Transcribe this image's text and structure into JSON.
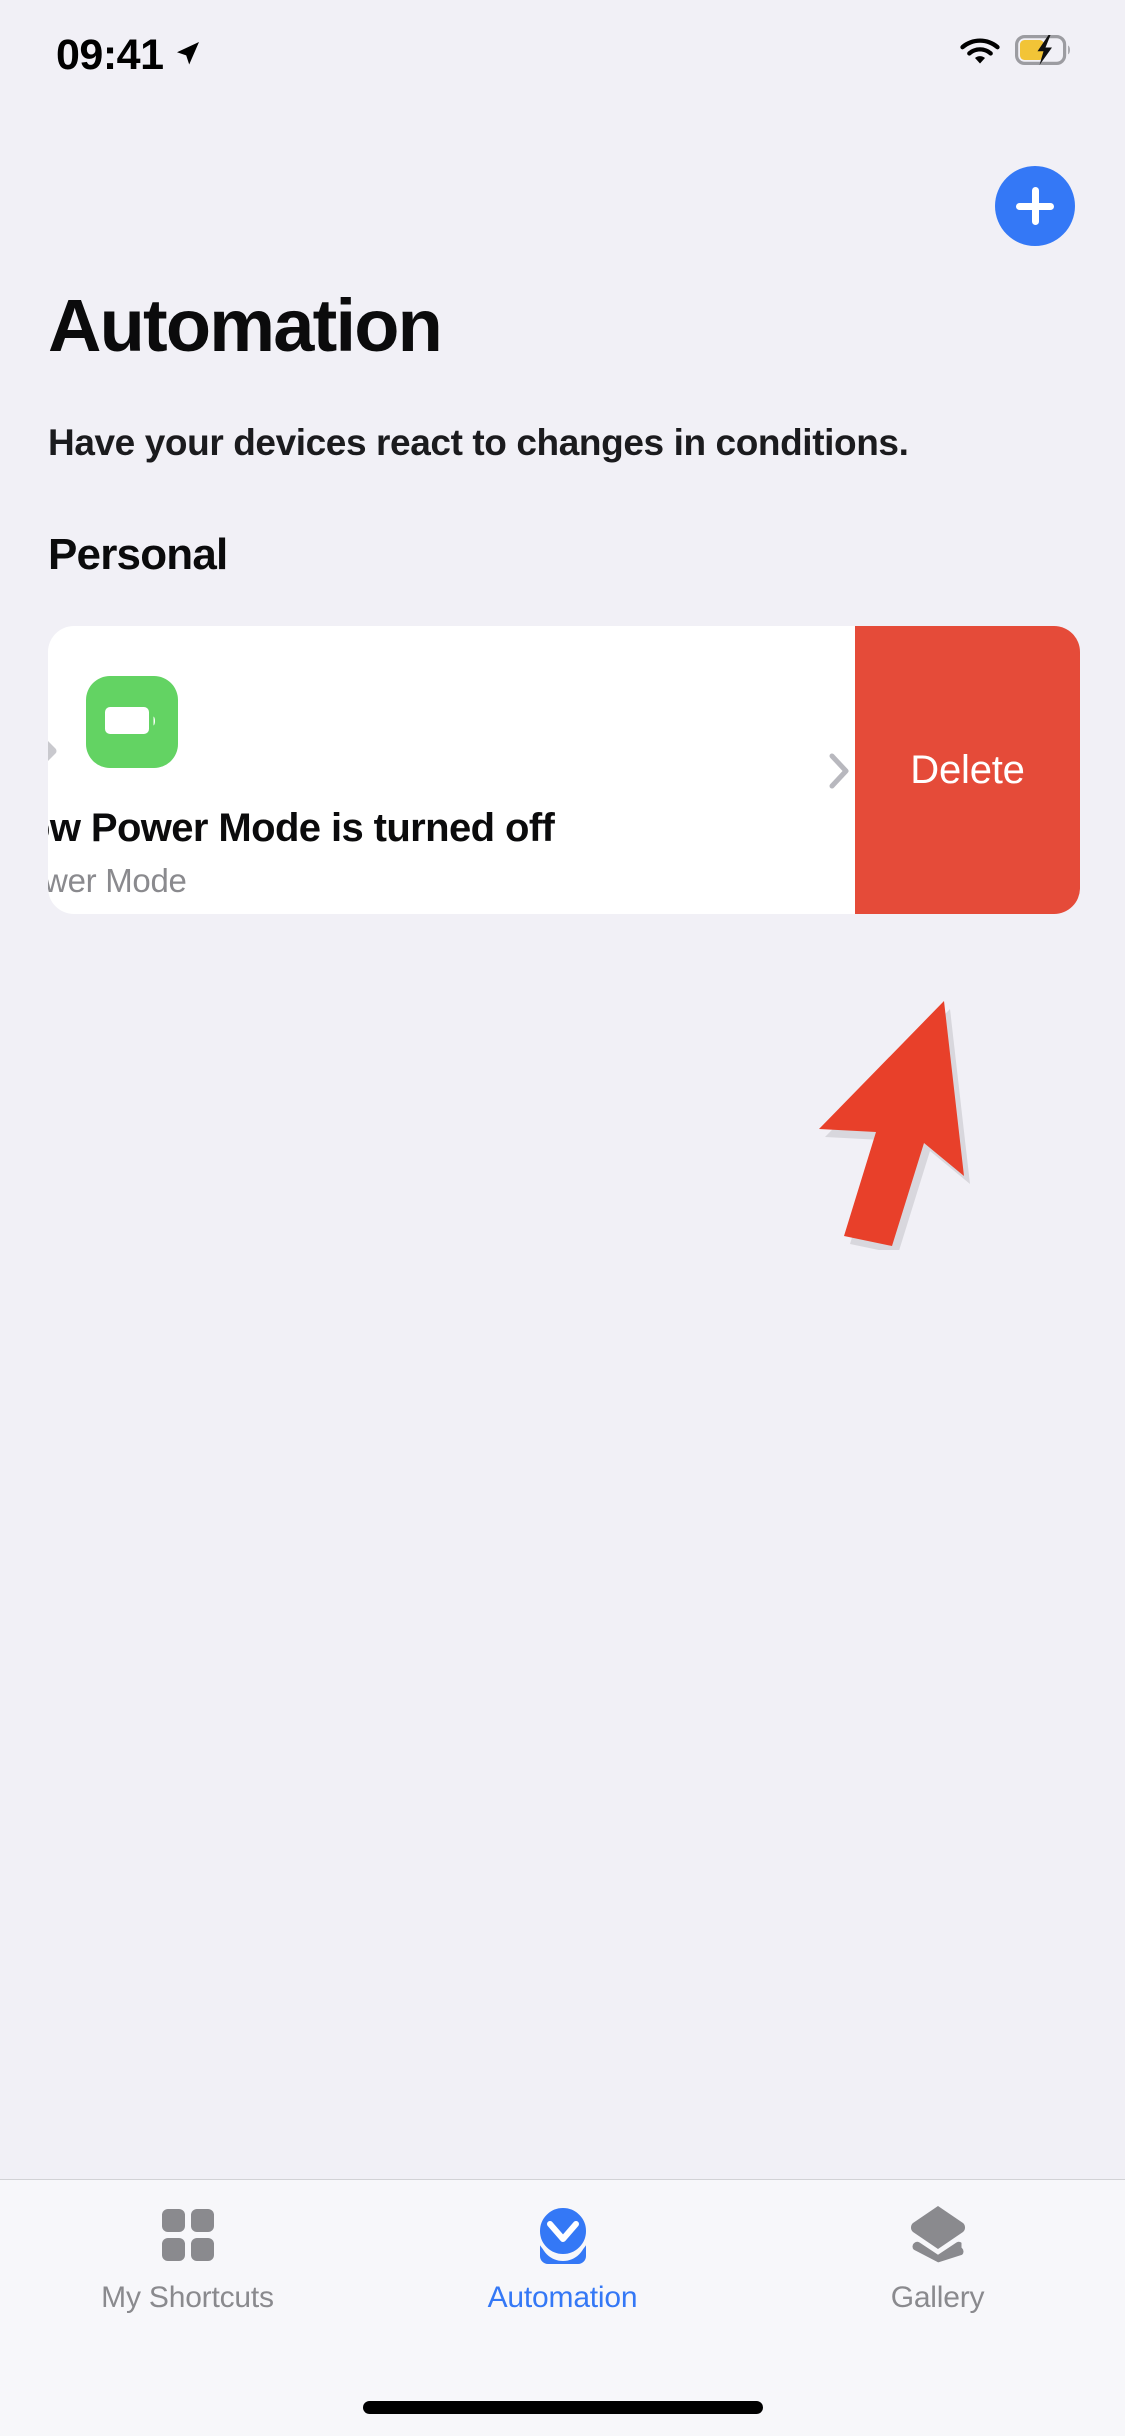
{
  "status_bar": {
    "time": "09:41",
    "location_icon": "location-arrow-icon",
    "wifi_icon": "wifi-icon",
    "battery_icon": "battery-charging-icon",
    "battery_level_percent": 55,
    "battery_fill_color": "#F2C437",
    "charging": true
  },
  "nav": {
    "add_button_label": "+",
    "add_button_name": "add-automation-button",
    "accent_color": "#3478F6"
  },
  "header": {
    "title": "Automation",
    "subtitle": "Have your devices react to changes in conditions."
  },
  "sections": [
    {
      "title": "Personal",
      "rows": [
        {
          "icon_name": "battery-icon",
          "icon_bg_color": "#63D363",
          "title": "ow Power Mode is turned off",
          "title_full": "When Low Power Mode is turned off",
          "subtitle": "ower Mode",
          "subtitle_full": "Low Power Mode",
          "disclosure_icon": "chevron-right-icon",
          "swipe_state": "open",
          "swipe_action": {
            "label": "Delete",
            "color": "#E54B39"
          }
        }
      ]
    }
  ],
  "annotation": {
    "cursor_icon": "arrow-cursor",
    "cursor_color": "#E8402A"
  },
  "tab_bar": {
    "items": [
      {
        "label": "My Shortcuts",
        "icon": "grid-squares-icon",
        "active": false
      },
      {
        "label": "Automation",
        "icon": "automation-check-icon",
        "active": true
      },
      {
        "label": "Gallery",
        "icon": "layers-icon",
        "active": false
      }
    ],
    "active_color": "#3478F6",
    "inactive_color": "#8A8A8E"
  },
  "system": {
    "home_indicator": "home-indicator"
  },
  "colors": {
    "background": "#F1F0F6",
    "card_background": "#FFFFFF",
    "tab_bar_background": "#F7F7FA"
  }
}
